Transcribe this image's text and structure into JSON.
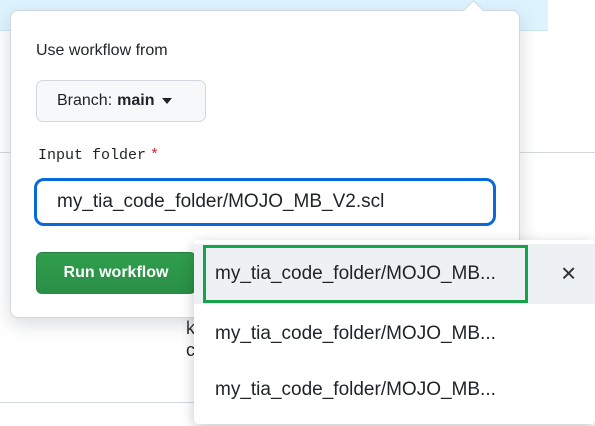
{
  "workflow_dispatch": {
    "use_workflow_label": "Use workflow from",
    "branch_prefix": "Branch:",
    "branch_name": "main",
    "input_label": "Input folder",
    "required_marker": "*",
    "input_value": "my_tia_code_folder/MOJO_MB_V2.scl",
    "run_button_label": "Run workflow"
  },
  "autocomplete": {
    "items": [
      {
        "label": "my_tia_code_folder/MOJO_MB..."
      },
      {
        "label": "my_tia_code_folder/MOJO_MB..."
      },
      {
        "label": "my_tia_code_folder/MOJO_MB..."
      }
    ],
    "remove_icon": "close-icon",
    "remove_glyph": "✕"
  },
  "background": {
    "partial_glyph_1": "k",
    "partial_glyph_2": "c"
  },
  "colors": {
    "primary_green": "#2da44e",
    "focus_blue": "#0969da",
    "highlight_green": "#16a34a",
    "required_red": "#cf222e"
  }
}
